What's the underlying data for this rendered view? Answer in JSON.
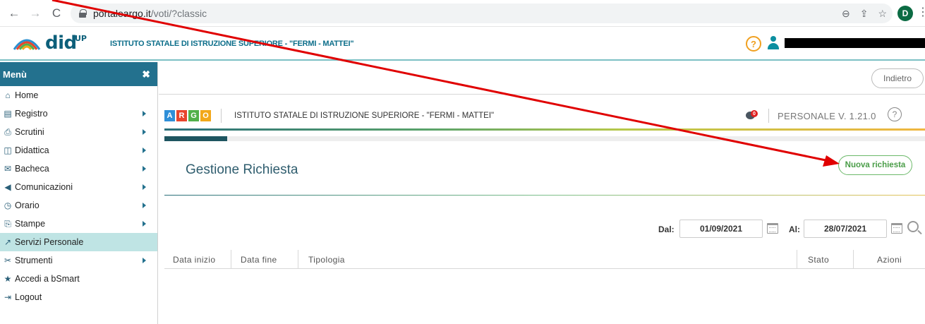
{
  "browser": {
    "back": "←",
    "forward": "→",
    "reload": "C",
    "url_host": "portaleargo.it",
    "url_path": "/voti/?classic",
    "zoom": "⊖",
    "share": "⇪",
    "star": "☆",
    "profile_initial": "D",
    "menu": "⋮"
  },
  "app_header": {
    "logo_text": "did",
    "logo_sup": "UP",
    "school_name": "ISTITUTO STATALE DI ISTRUZIONE SUPERIORE - \"FERMI - MATTEI\"",
    "help": "?"
  },
  "sidebar": {
    "title": "Menù",
    "close": "✖",
    "items": [
      {
        "label": "Home",
        "icon": "⌂",
        "has_arrow": false
      },
      {
        "label": "Registro",
        "icon": "▤",
        "has_arrow": true
      },
      {
        "label": "Scrutini",
        "icon": "⎙",
        "has_arrow": true
      },
      {
        "label": "Didattica",
        "icon": "◫",
        "has_arrow": true
      },
      {
        "label": "Bacheca",
        "icon": "✉",
        "has_arrow": true
      },
      {
        "label": "Comunicazioni",
        "icon": "◀",
        "has_arrow": true
      },
      {
        "label": "Orario",
        "icon": "◷",
        "has_arrow": true
      },
      {
        "label": "Stampe",
        "icon": "⎘",
        "has_arrow": true
      },
      {
        "label": "Servizi Personale",
        "icon": "↗",
        "has_arrow": false,
        "active": true
      },
      {
        "label": "Strumenti",
        "icon": "✂",
        "has_arrow": true
      },
      {
        "label": "Accedi a bSmart",
        "icon": "★",
        "has_arrow": false
      },
      {
        "label": "Logout",
        "icon": "⇥",
        "has_arrow": false
      }
    ]
  },
  "main": {
    "back_button": "Indietro",
    "argo_letters": [
      "A",
      "R",
      "G",
      "O"
    ],
    "argo_colors": [
      "#2f8fd8",
      "#e8442c",
      "#52b04a",
      "#f2a81a"
    ],
    "school_name": "ISTITUTO STATALE DI ISTRUZIONE SUPERIORE - \"FERMI - MATTEI\"",
    "notification_count": "0",
    "version_label": "PERSONALE V. 1.21.0",
    "version_help": "?",
    "page_title": "Gestione Richiesta",
    "new_request_button": "Nuova richiesta",
    "filter": {
      "from_label": "Dal:",
      "from_value": "01/09/2021",
      "to_label": "Al:",
      "to_value": "28/07/2021"
    },
    "table": {
      "columns": [
        "Data inizio",
        "Data fine",
        "Tipologia",
        "Stato",
        "Azioni"
      ],
      "rows": []
    }
  },
  "colors": {
    "menu_header": "#23718e",
    "active_item": "#bfe4e4",
    "new_request_accent": "#4a9d48",
    "annotation_arrow": "#e00000"
  }
}
